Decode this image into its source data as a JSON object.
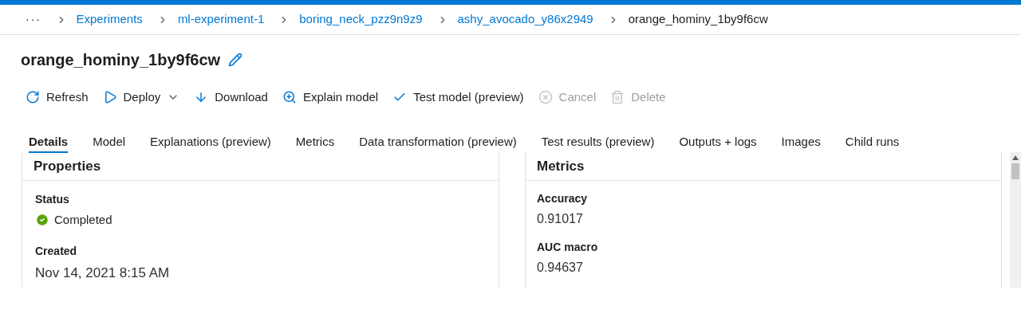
{
  "breadcrumb": {
    "overflow": "···",
    "items": [
      {
        "label": "Experiments",
        "current": false
      },
      {
        "label": "ml-experiment-1",
        "current": false
      },
      {
        "label": "boring_neck_pzz9n9z9",
        "current": false
      },
      {
        "label": "ashy_avocado_y86x2949",
        "current": false
      },
      {
        "label": "orange_hominy_1by9f6cw",
        "current": true
      }
    ]
  },
  "title": "orange_hominy_1by9f6cw",
  "toolbar": [
    {
      "kind": "refresh",
      "label": "Refresh",
      "disabled": false
    },
    {
      "kind": "deploy",
      "label": "Deploy",
      "disabled": false
    },
    {
      "kind": "download",
      "label": "Download",
      "disabled": false
    },
    {
      "kind": "explain",
      "label": "Explain model",
      "disabled": false
    },
    {
      "kind": "test",
      "label": "Test model (preview)",
      "disabled": false
    },
    {
      "kind": "cancel",
      "label": "Cancel",
      "disabled": true
    },
    {
      "kind": "delete",
      "label": "Delete",
      "disabled": true
    }
  ],
  "tabs": [
    {
      "label": "Details",
      "selected": true
    },
    {
      "label": "Model",
      "selected": false
    },
    {
      "label": "Explanations (preview)",
      "selected": false
    },
    {
      "label": "Metrics",
      "selected": false
    },
    {
      "label": "Data transformation (preview)",
      "selected": false
    },
    {
      "label": "Test results (preview)",
      "selected": false
    },
    {
      "label": "Outputs + logs",
      "selected": false
    },
    {
      "label": "Images",
      "selected": false
    },
    {
      "label": "Child runs",
      "selected": false
    }
  ],
  "properties": {
    "title": "Properties",
    "fields": [
      {
        "kind": "status",
        "label": "Status",
        "value": "Completed"
      },
      {
        "kind": "text",
        "label": "Created",
        "value": "Nov 14, 2021 8:15 AM"
      }
    ]
  },
  "metrics": {
    "title": "Metrics",
    "items": [
      {
        "label": "Accuracy",
        "value": "0.91017"
      },
      {
        "label": "AUC macro",
        "value": "0.94637"
      }
    ]
  }
}
